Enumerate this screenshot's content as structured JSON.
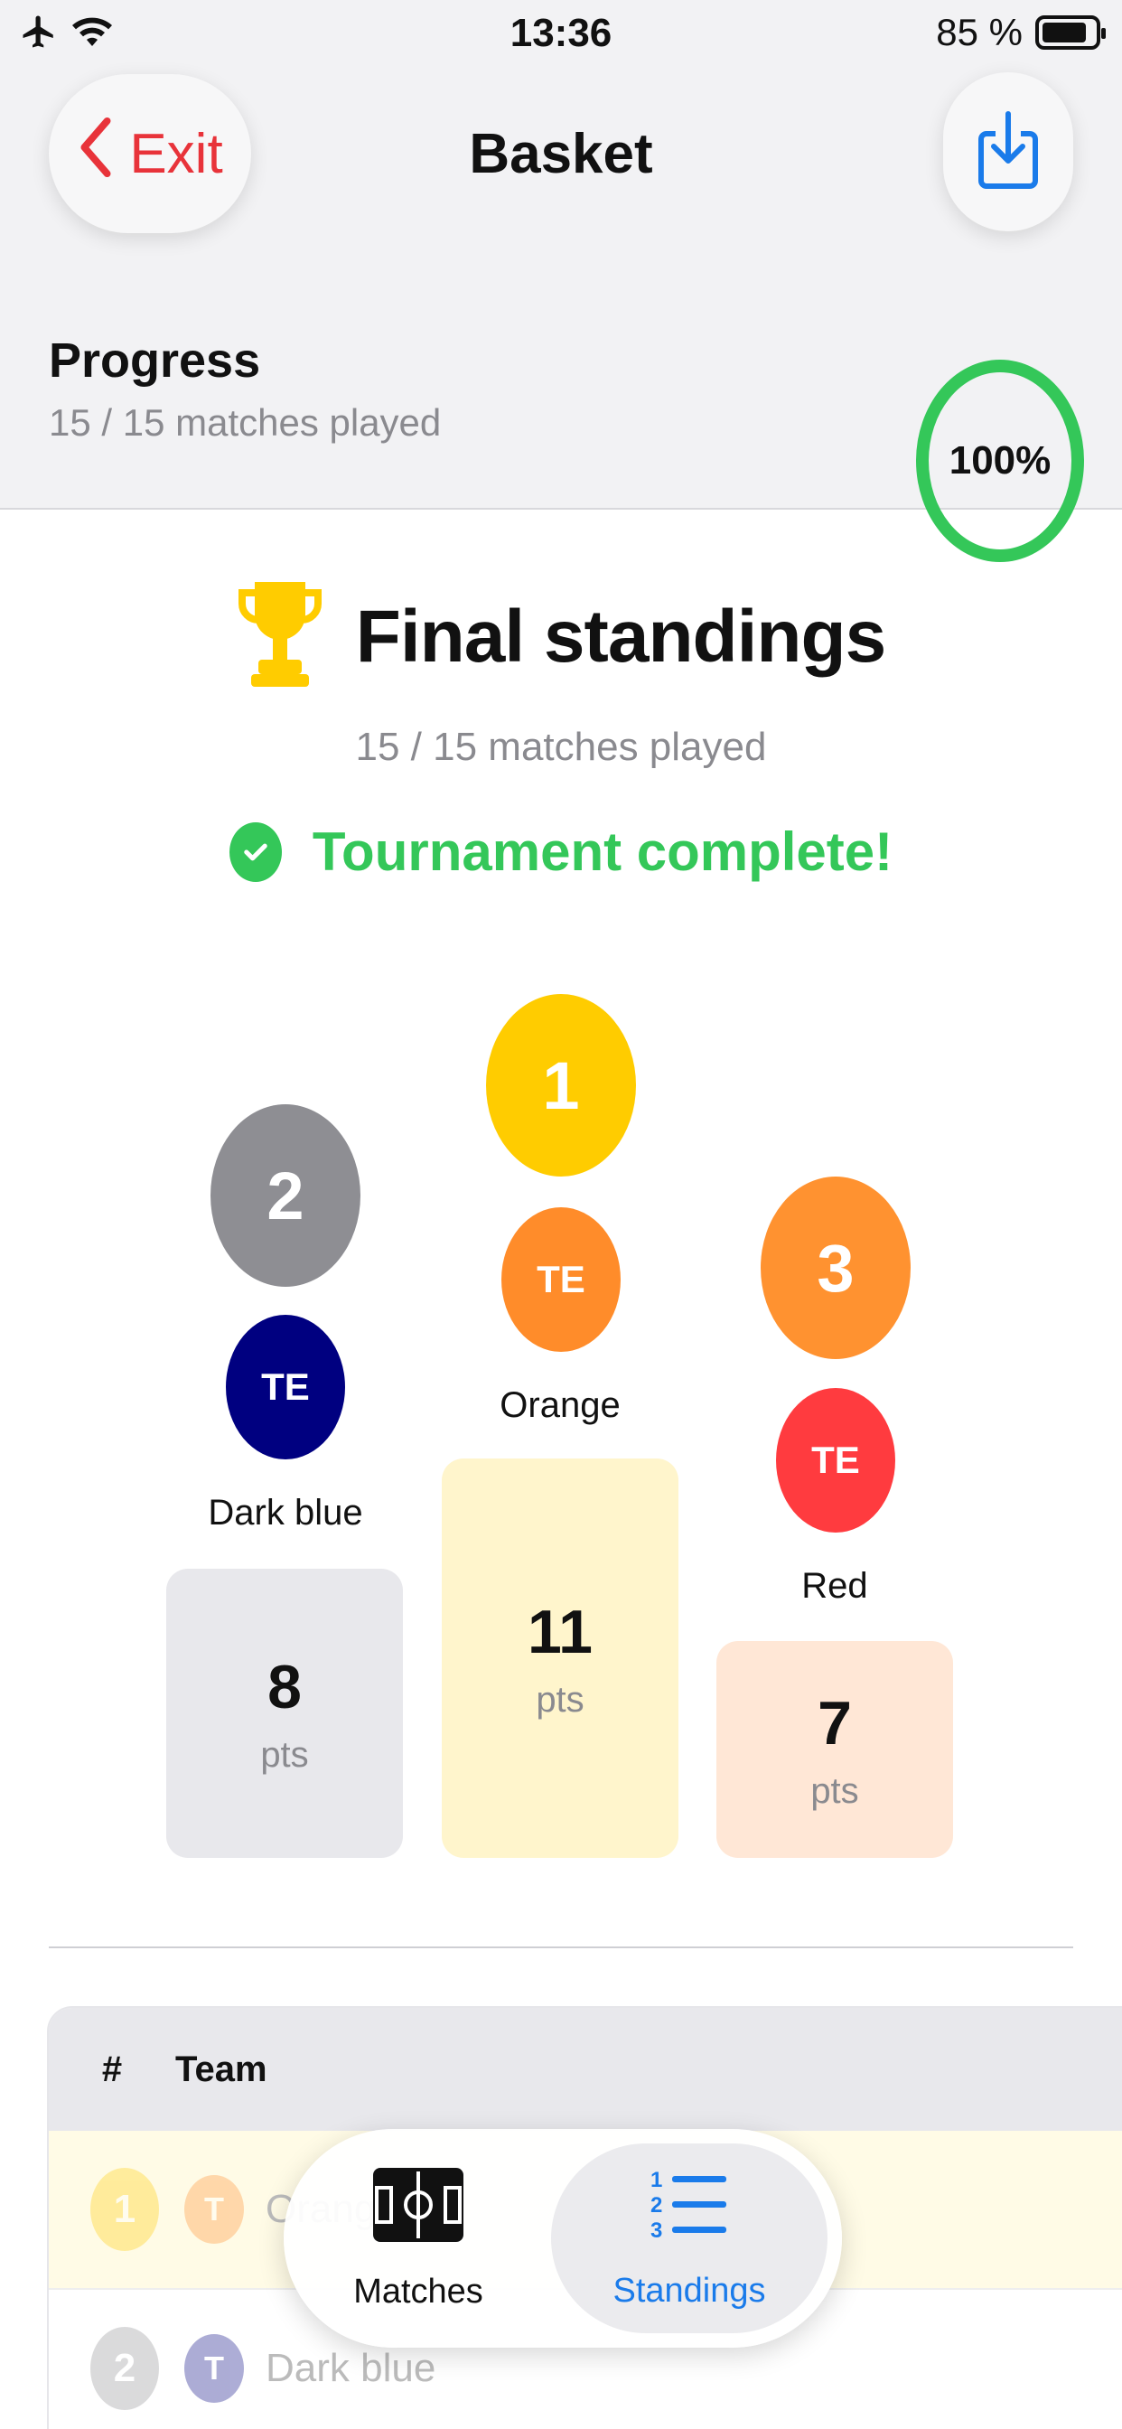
{
  "status_bar": {
    "time": "13:36",
    "battery_text": "85 %"
  },
  "header": {
    "exit_label": "Exit",
    "title": "Basket",
    "progress_title": "Progress",
    "progress_sub": "15 / 15 matches played",
    "progress_percent": "100%"
  },
  "final": {
    "title": "Final standings",
    "sub": "15 / 15 matches played",
    "complete_label": "Tournament complete!"
  },
  "podium": {
    "first": {
      "rank": "1",
      "initials": "TE",
      "name": "Orange",
      "points": "11",
      "unit": "pts"
    },
    "second": {
      "rank": "2",
      "initials": "TE",
      "name": "Dark blue",
      "points": "8",
      "unit": "pts"
    },
    "third": {
      "rank": "3",
      "initials": "TE",
      "name": "Red",
      "points": "7",
      "unit": "pts"
    }
  },
  "table": {
    "col_rank": "#",
    "col_team": "Team",
    "rows": [
      {
        "rank": "1",
        "initial": "T",
        "name": "Orange"
      },
      {
        "rank": "2",
        "initial": "T",
        "name": "Dark blue"
      }
    ]
  },
  "tabs": {
    "matches": "Matches",
    "standings": "Standings"
  },
  "colors": {
    "gold": "#ffcc00",
    "silver": "#8e8e93",
    "bronze": "#ff9230",
    "orange_team": "#ff8c2a",
    "darkblue_team": "#000080",
    "red_team": "#ff3b3f",
    "green": "#34c759",
    "accent_blue": "#1a7bea",
    "exit_red": "#e8333a"
  }
}
